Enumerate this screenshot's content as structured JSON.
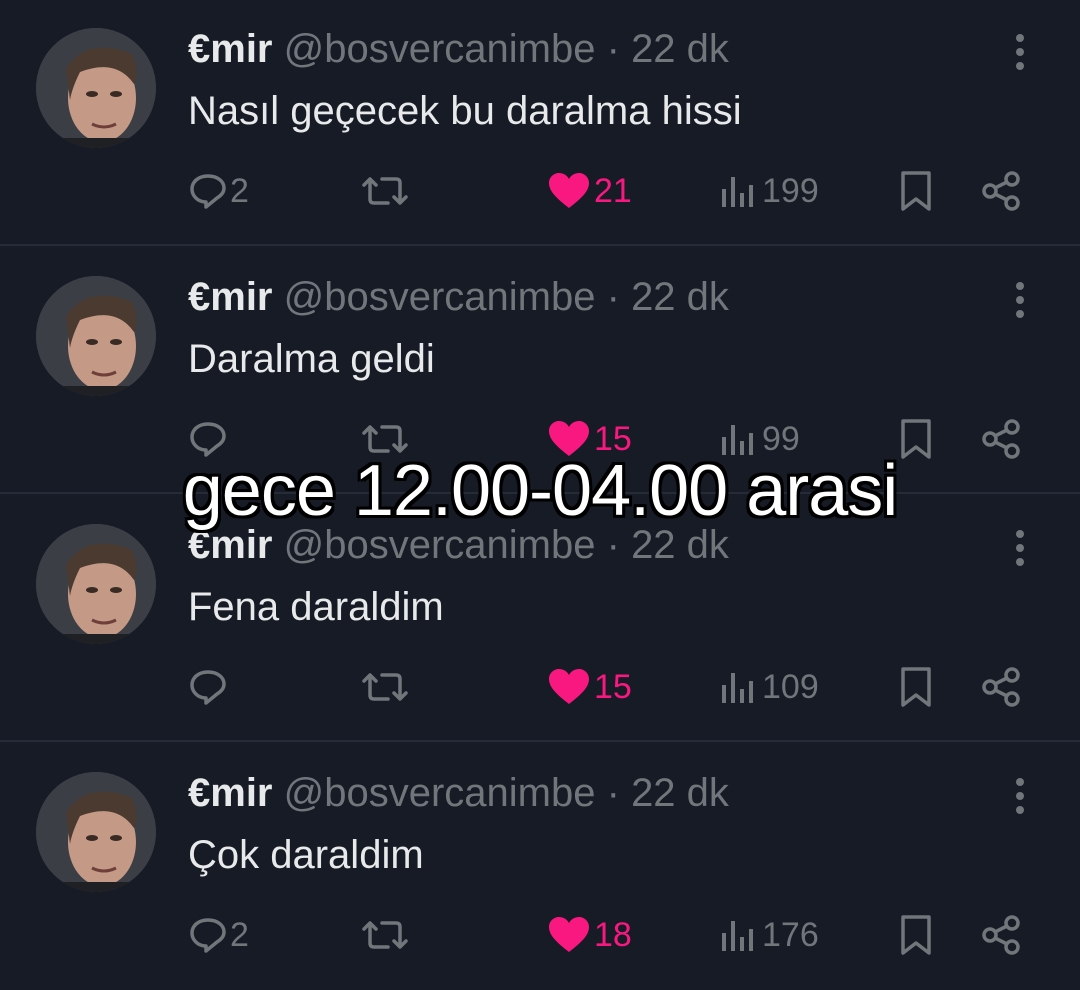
{
  "overlay_caption": "gece 12.00-04.00 arasi",
  "colors": {
    "background": "#161b25",
    "text": "#e7e9ea",
    "muted": "#71767b",
    "like": "#f91880"
  },
  "tweets": [
    {
      "display_name": "€mir",
      "handle": "@bosvercanimbe",
      "separator": "·",
      "time": "22 dk",
      "text": "Nasıl geçecek bu daralma hissi",
      "replies": "2",
      "likes": "21",
      "views": "199",
      "icons": [
        "reply-icon",
        "retweet-icon",
        "heart-icon",
        "views-icon",
        "bookmark-icon",
        "share-icon",
        "more-icon"
      ]
    },
    {
      "display_name": "€mir",
      "handle": "@bosvercanimbe",
      "separator": "·",
      "time": "22 dk",
      "text": "Daralma geldi",
      "replies": "",
      "likes": "15",
      "views": "99",
      "icons": [
        "reply-icon",
        "retweet-icon",
        "heart-icon",
        "views-icon",
        "bookmark-icon",
        "share-icon",
        "more-icon"
      ]
    },
    {
      "display_name": "€mir",
      "handle": "@bosvercanimbe",
      "separator": "·",
      "time": "22 dk",
      "text": "Fena daraldim",
      "replies": "",
      "likes": "15",
      "views": "109",
      "icons": [
        "reply-icon",
        "retweet-icon",
        "heart-icon",
        "views-icon",
        "bookmark-icon",
        "share-icon",
        "more-icon"
      ]
    },
    {
      "display_name": "€mir",
      "handle": "@bosvercanimbe",
      "separator": "·",
      "time": "22 dk",
      "text": "Çok daraldim",
      "replies": "2",
      "likes": "18",
      "views": "176",
      "icons": [
        "reply-icon",
        "retweet-icon",
        "heart-icon",
        "views-icon",
        "bookmark-icon",
        "share-icon",
        "more-icon"
      ]
    }
  ]
}
